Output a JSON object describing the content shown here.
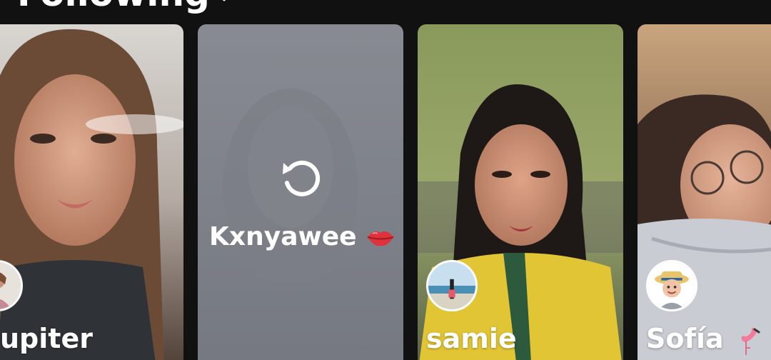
{
  "header": {
    "title": "Following",
    "chevron_icon": "chevron-down-icon"
  },
  "stories": [
    {
      "name": "upiter",
      "state": "playable",
      "avatar_icon": "avatar"
    },
    {
      "name": "Kxnyawee",
      "name_emoji": "lips-kiss-icon",
      "state": "loading",
      "overlay_icon": "replay-icon"
    },
    {
      "name": "samie",
      "state": "playable",
      "avatar_icon": "avatar"
    },
    {
      "name": "Sofía",
      "name_emoji": "flamingo-icon",
      "state": "playable",
      "avatar_icon": "avatar-bitmoji"
    }
  ],
  "colors": {
    "background": "#111111",
    "text": "#ffffff",
    "loading_card": "#6f727a"
  }
}
